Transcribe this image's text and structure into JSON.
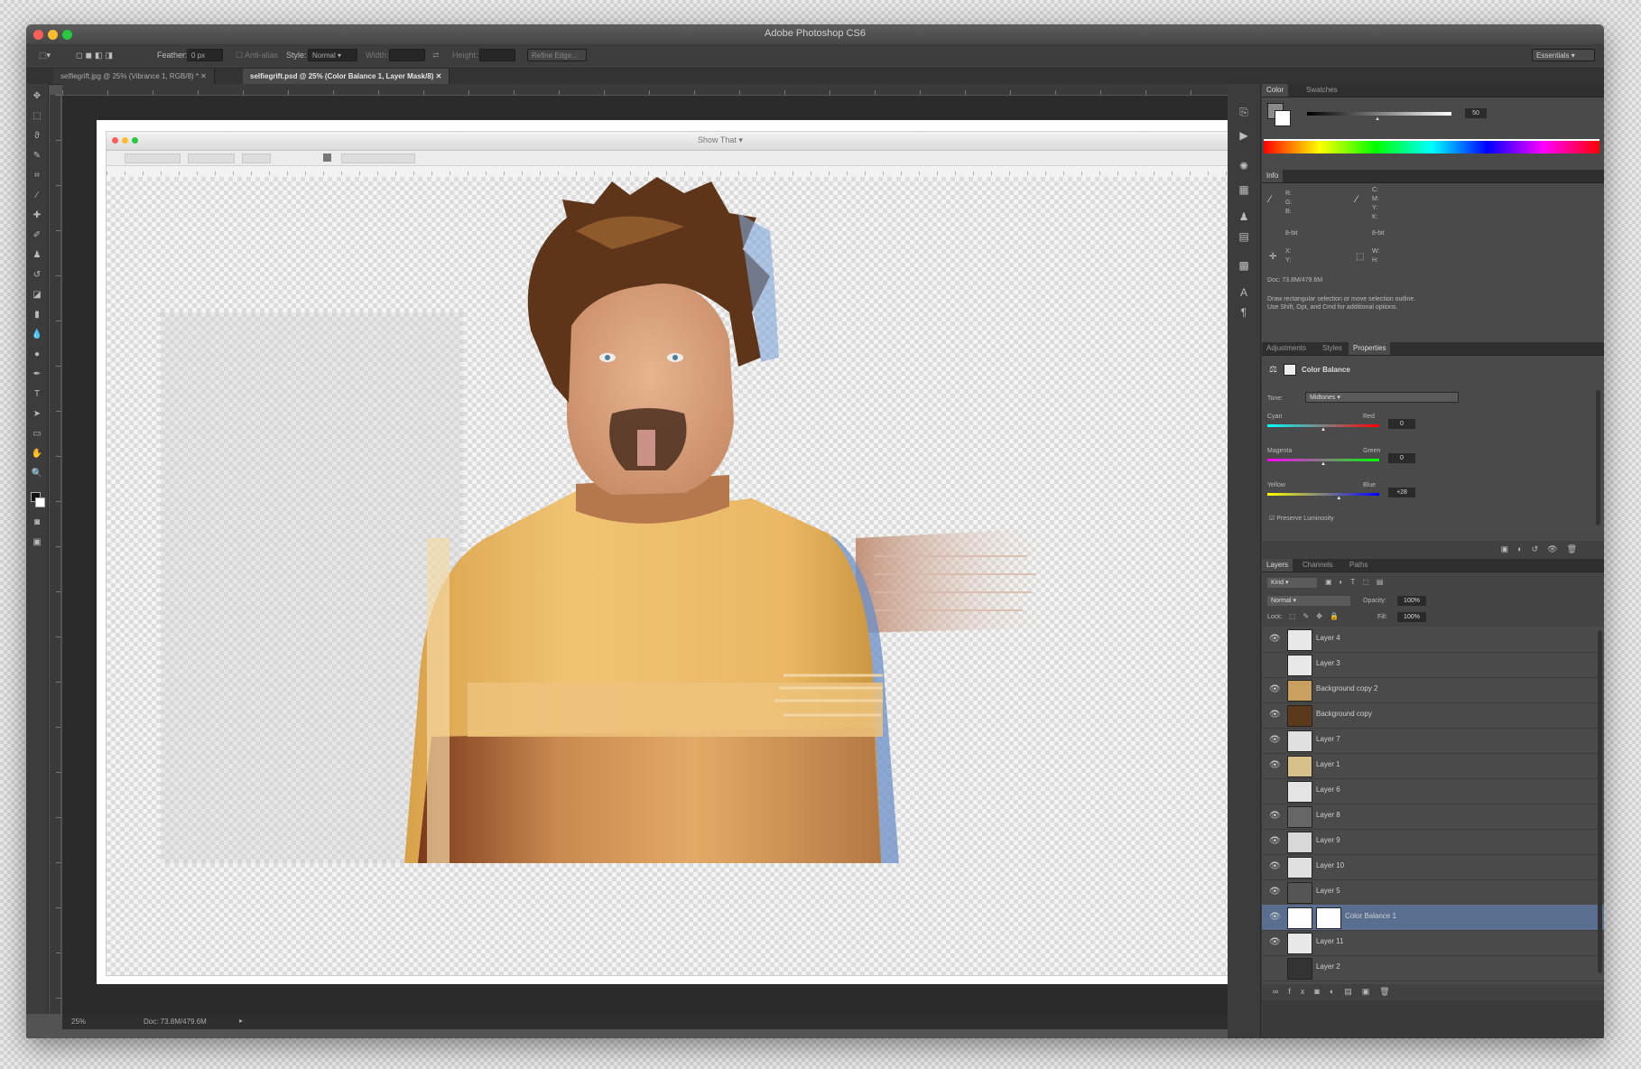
{
  "app": {
    "title": "Adobe Photoshop CS6",
    "workspace": "Essentials"
  },
  "options_bar": {
    "feather_label": "Feather:",
    "feather_value": "0 px",
    "antialias_label": "Anti-alias",
    "style_label": "Style:",
    "style_value": "Normal",
    "width_label": "Width:",
    "height_label": "Height:",
    "refine_edge": "Refine Edge..."
  },
  "document_tabs": [
    {
      "label": "selfiegrift.jpg @ 25% (Vibrance 1, RGB/8) *"
    },
    {
      "label": "selfiegrift.psd @ 25% (Color Balance 1, Layer Mask/8)"
    }
  ],
  "inner_window": {
    "title": "Show That ▾"
  },
  "status_bar": {
    "zoom": "25%",
    "doc": "Doc: 73.8M/479.6M"
  },
  "panels": {
    "color_tabs": [
      "Color",
      "Swatches"
    ],
    "color_value": "50",
    "info_title": "Info",
    "info_doc": "Doc: 73.8M/479.6M",
    "info_hint": "Draw rectangular selection or move selection outline. Use Shift, Opt, and Cmd for additional options.",
    "info_values": {
      "r": "R:",
      "g": "G:",
      "b": "B:",
      "c": "C:",
      "m": "M:",
      "y": "Y:",
      "k": "K:",
      "bits_left": "8-bit",
      "bits_right": "8-bit",
      "x": "X:",
      "y2": "Y:",
      "w": "W:",
      "h": "H:"
    },
    "adjust_tabs": [
      "Adjustments",
      "Styles",
      "Properties"
    ],
    "properties": {
      "title": "Color Balance",
      "tone_label": "Tone:",
      "tone_value": "Midtones",
      "sliders": [
        {
          "left": "Cyan",
          "right": "Red",
          "value": "0",
          "position": 0.5
        },
        {
          "left": "Magenta",
          "right": "Green",
          "value": "0",
          "position": 0.5
        },
        {
          "left": "Yellow",
          "right": "Blue",
          "value": "+28",
          "position": 0.64
        }
      ],
      "preserve": "Preserve Luminosity"
    },
    "layers_tabs": [
      "Layers",
      "Channels",
      "Paths"
    ],
    "kind_label": "Kind",
    "blend_mode": "Normal",
    "opacity_label": "Opacity:",
    "opacity_value": "100%",
    "lock_label": "Lock:",
    "fill_label": "Fill:",
    "fill_value": "100%",
    "layers": [
      {
        "name": "Layer 4",
        "visible": true,
        "selected": false
      },
      {
        "name": "Layer 3",
        "visible": false,
        "selected": false
      },
      {
        "name": "Background copy 2",
        "visible": true,
        "selected": false
      },
      {
        "name": "Background copy",
        "visible": true,
        "selected": false
      },
      {
        "name": "Layer 7",
        "visible": true,
        "selected": false
      },
      {
        "name": "Layer 1",
        "visible": true,
        "selected": false
      },
      {
        "name": "Layer 6",
        "visible": false,
        "selected": false
      },
      {
        "name": "Layer 8",
        "visible": true,
        "selected": false
      },
      {
        "name": "Layer 9",
        "visible": true,
        "selected": false
      },
      {
        "name": "Layer 10",
        "visible": true,
        "selected": false
      },
      {
        "name": "Layer 5",
        "visible": true,
        "selected": false
      },
      {
        "name": "Color Balance 1",
        "visible": true,
        "selected": true
      },
      {
        "name": "Layer 11",
        "visible": true,
        "selected": false
      },
      {
        "name": "Layer 2",
        "visible": false,
        "selected": false
      }
    ]
  },
  "colors": {
    "shirt": "#e9b85f",
    "skin": "#c9906a",
    "hair": "#6b3e1d",
    "selected_layer": "#5a6f8f"
  }
}
